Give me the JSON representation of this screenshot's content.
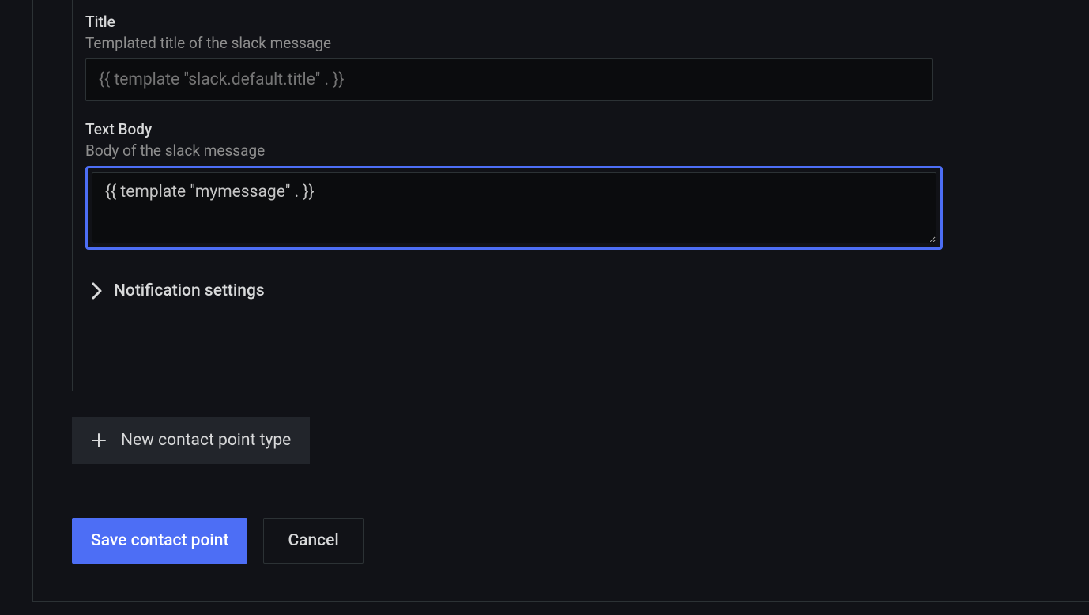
{
  "fields": {
    "title": {
      "label": "Title",
      "description": "Templated title of the slack message",
      "placeholder": "{{ template \"slack.default.title\" . }}",
      "value": ""
    },
    "textBody": {
      "label": "Text Body",
      "description": "Body of the slack message",
      "value": "{{ template \"mymessage\" . }}"
    }
  },
  "notificationSettings": {
    "label": "Notification settings"
  },
  "buttons": {
    "newContactPoint": "New contact point type",
    "save": "Save contact point",
    "cancel": "Cancel"
  }
}
